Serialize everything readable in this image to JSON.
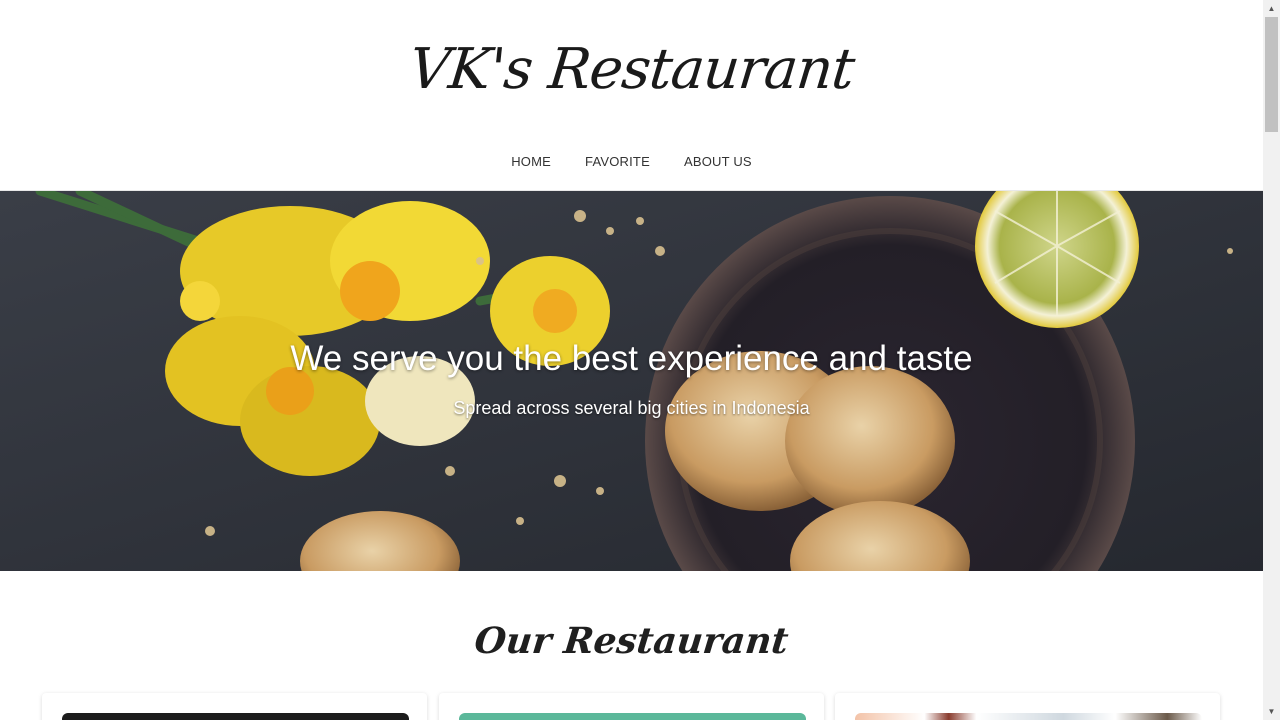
{
  "header": {
    "brand": "VK's Restaurant",
    "nav": [
      {
        "label": "HOME"
      },
      {
        "label": "FAVORITE"
      },
      {
        "label": "ABOUT US"
      }
    ]
  },
  "hero": {
    "title": "We serve you the best experience and taste",
    "subtitle": "Spread across several big cities in Indonesia"
  },
  "section": {
    "title": "Our Restaurant"
  },
  "colors": {
    "hero_bg": "#2c2f36",
    "text_dark": "#1a1a1a",
    "nav_text": "#333333"
  }
}
